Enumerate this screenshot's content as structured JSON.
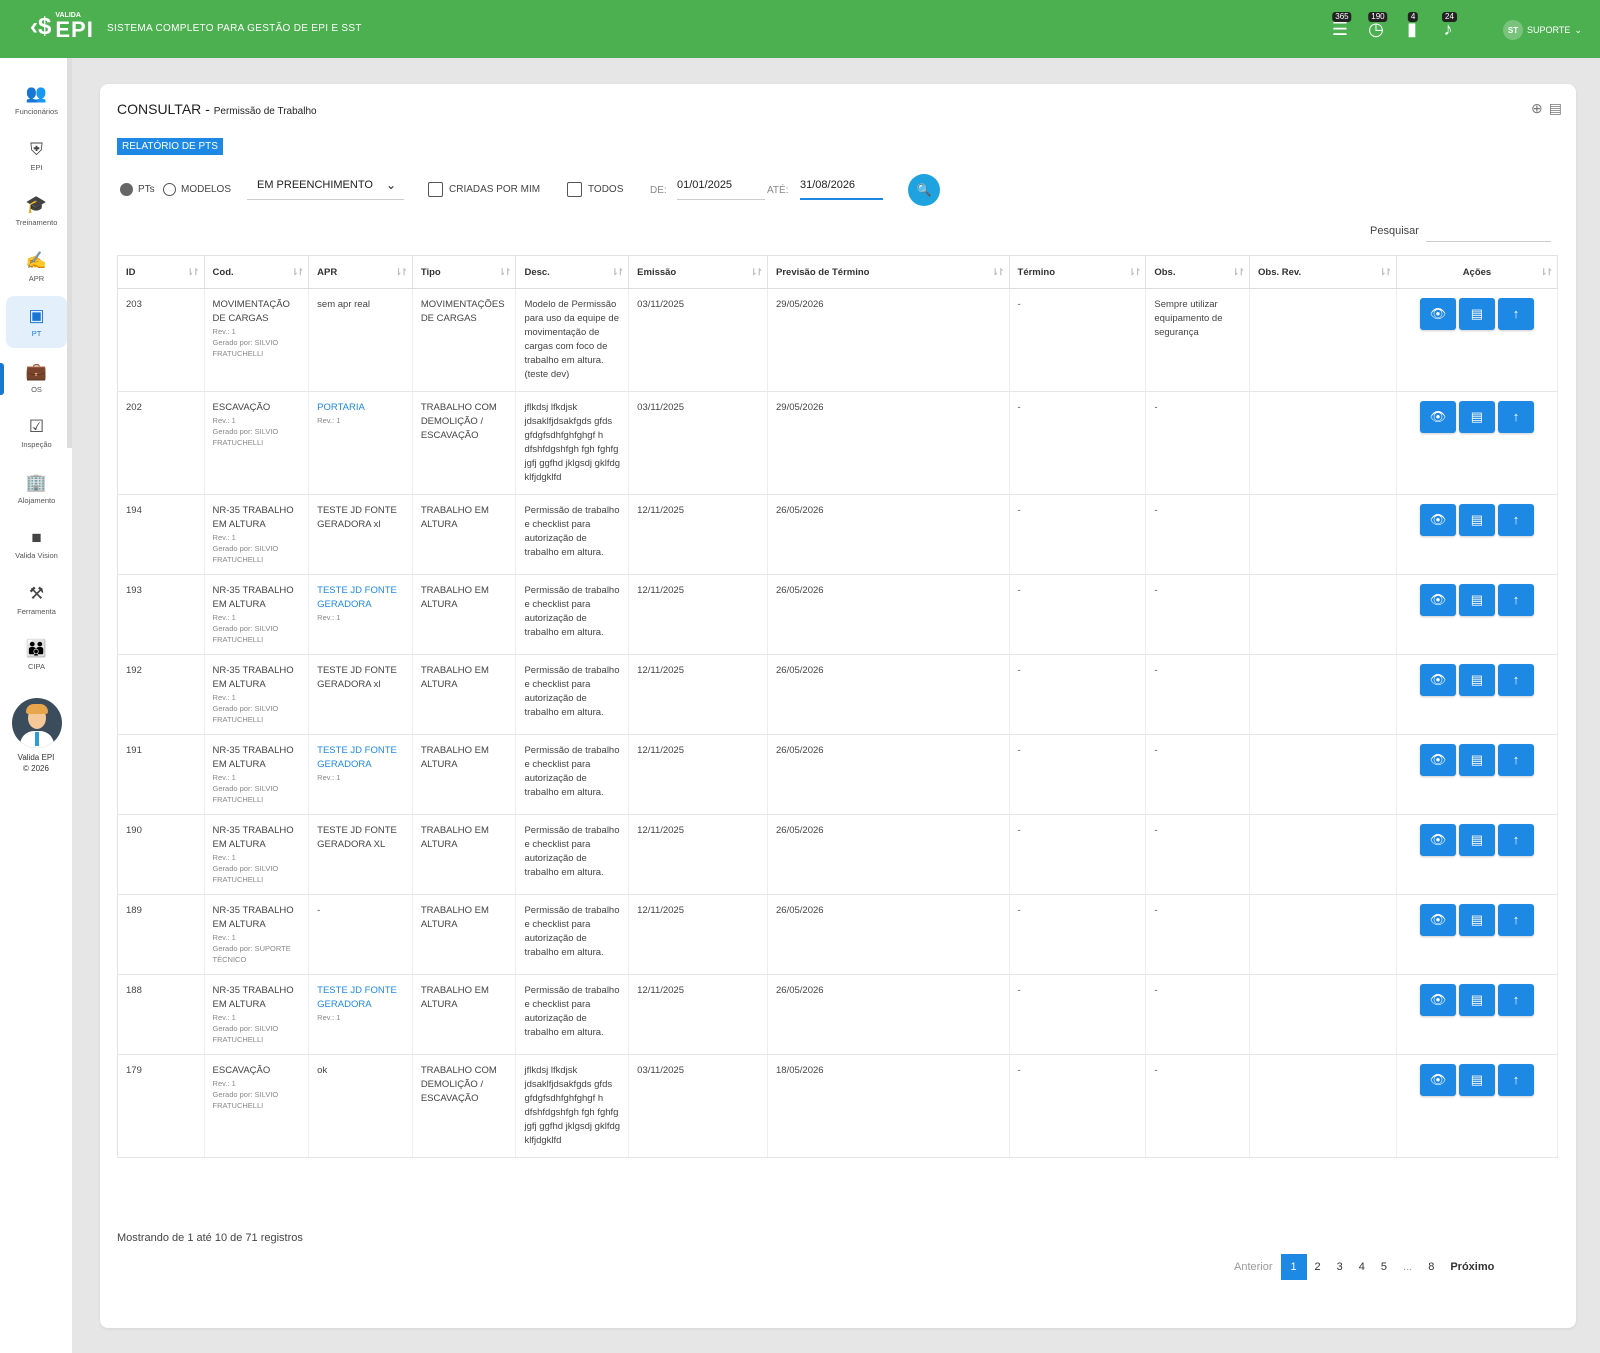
{
  "app": {
    "brand_small": "VALIDA",
    "brand_big": "EPI",
    "system_title": "SISTEMA COMPLETO PARA GESTÃO DE EPI E SST",
    "badges": [
      "365",
      "190",
      "4",
      "24"
    ],
    "user_initials": "ST",
    "user_name": "SUPORTE"
  },
  "sidebar": {
    "items": [
      {
        "label": "Funcionários",
        "icon": "people-icon"
      },
      {
        "label": "EPI",
        "icon": "shield-icon"
      },
      {
        "label": "Treinamento",
        "icon": "graduation-icon"
      },
      {
        "label": "APR",
        "icon": "signature-icon"
      },
      {
        "label": "PT",
        "icon": "folder-user-icon"
      },
      {
        "label": "OS",
        "icon": "briefcase-icon"
      },
      {
        "label": "Inspeção",
        "icon": "checklist-icon"
      },
      {
        "label": "Alojamento",
        "icon": "building-icon"
      },
      {
        "label": "Valida Vision",
        "icon": "video-icon"
      },
      {
        "label": "Ferramenta",
        "icon": "tools-icon"
      },
      {
        "label": "CIPA",
        "icon": "group-icon"
      }
    ],
    "footer_line1": "Valida EPI",
    "footer_line2": "© 2026"
  },
  "page": {
    "title": "CONSULTAR",
    "subtitle": "Permissão de Trabalho",
    "report_button": "RELATÓRIO DE PTS"
  },
  "filters": {
    "radio_pts": "PTs",
    "radio_modelos": "MODELOS",
    "status_select": "EM PREENCHIMENTO",
    "check_criadas": "CRIADAS POR MIM",
    "check_todos": "TODOS",
    "de_label": "DE:",
    "de_value": "01/01/2025",
    "ate_label": "ATÉ:",
    "ate_value": "31/08/2026"
  },
  "search": {
    "label": "Pesquisar",
    "value": ""
  },
  "table": {
    "headers": [
      "ID",
      "Cod.",
      "APR",
      "Tipo",
      "Desc.",
      "Emissão",
      "Previsão de Término",
      "Término",
      "Obs.",
      "Obs. Rev.",
      "Ações"
    ],
    "rows": [
      {
        "id": "203",
        "cod": "MOVIMENTAÇÃO DE CARGAS",
        "rev": "Rev.: 1",
        "gerado": "Gerado por: SILVIO FRATUCHELLI",
        "apr": "sem apr real",
        "apr_link": false,
        "apr_rev": "",
        "tipo": "MOVIMENTAÇÕES DE CARGAS",
        "desc": "Modelo de Permissão para uso da equipe de movimentação de cargas com foco de trabalho em altura. (teste dev)",
        "emissao": "03/11/2025",
        "previsao": "29/05/2026",
        "termino": "-",
        "obs": "Sempre utilizar equipamento de segurança",
        "obsrev": ""
      },
      {
        "id": "202",
        "cod": "ESCAVAÇÃO",
        "rev": "Rev.: 1",
        "gerado": "Gerado por: SILVIO FRATUCHELLI",
        "apr": "PORTARIA",
        "apr_link": true,
        "apr_rev": "Rev.: 1",
        "tipo": "TRABALHO COM DEMOLIÇÃO / ESCAVAÇÃO",
        "desc": "jflkdsj lfkdjsk jdsaklfjdsakfgds gfds gfdgfsdhfghfghgf h dfshfdgshfgh fgh fghfg jgfj ggfhd jklgsdj gklfdg klfjdgklfd",
        "emissao": "03/11/2025",
        "previsao": "29/05/2026",
        "termino": "-",
        "obs": "-",
        "obsrev": ""
      },
      {
        "id": "194",
        "cod": "NR-35 TRABALHO EM ALTURA",
        "rev": "Rev.: 1",
        "gerado": "Gerado por: SILVIO FRATUCHELLI",
        "apr": "TESTE JD FONTE GERADORA xl",
        "apr_link": false,
        "apr_rev": "",
        "tipo": "TRABALHO EM ALTURA",
        "desc": "Permissão de trabalho e checklist para autorização de trabalho em altura.",
        "emissao": "12/11/2025",
        "previsao": "26/05/2026",
        "termino": "-",
        "obs": "-",
        "obsrev": ""
      },
      {
        "id": "193",
        "cod": "NR-35 TRABALHO EM ALTURA",
        "rev": "Rev.: 1",
        "gerado": "Gerado por: SILVIO FRATUCHELLI",
        "apr": "TESTE JD FONTE GERADORA",
        "apr_link": true,
        "apr_rev": "Rev.: 1",
        "tipo": "TRABALHO EM ALTURA",
        "desc": "Permissão de trabalho e checklist para autorização de trabalho em altura.",
        "emissao": "12/11/2025",
        "previsao": "26/05/2026",
        "termino": "-",
        "obs": "-",
        "obsrev": ""
      },
      {
        "id": "192",
        "cod": "NR-35 TRABALHO EM ALTURA",
        "rev": "Rev.: 1",
        "gerado": "Gerado por: SILVIO FRATUCHELLI",
        "apr": "TESTE JD FONTE GERADORA xl",
        "apr_link": false,
        "apr_rev": "",
        "tipo": "TRABALHO EM ALTURA",
        "desc": "Permissão de trabalho e checklist para autorização de trabalho em altura.",
        "emissao": "12/11/2025",
        "previsao": "26/05/2026",
        "termino": "-",
        "obs": "-",
        "obsrev": ""
      },
      {
        "id": "191",
        "cod": "NR-35 TRABALHO EM ALTURA",
        "rev": "Rev.: 1",
        "gerado": "Gerado por: SILVIO FRATUCHELLI",
        "apr": "TESTE JD FONTE GERADORA",
        "apr_link": true,
        "apr_rev": "Rev.: 1",
        "tipo": "TRABALHO EM ALTURA",
        "desc": "Permissão de trabalho e checklist para autorização de trabalho em altura.",
        "emissao": "12/11/2025",
        "previsao": "26/05/2026",
        "termino": "-",
        "obs": "-",
        "obsrev": ""
      },
      {
        "id": "190",
        "cod": "NR-35 TRABALHO EM ALTURA",
        "rev": "Rev.: 1",
        "gerado": "Gerado por: SILVIO FRATUCHELLI",
        "apr": "TESTE JD FONTE GERADORA XL",
        "apr_link": false,
        "apr_rev": "",
        "tipo": "TRABALHO EM ALTURA",
        "desc": "Permissão de trabalho e checklist para autorização de trabalho em altura.",
        "emissao": "12/11/2025",
        "previsao": "26/05/2026",
        "termino": "-",
        "obs": "-",
        "obsrev": ""
      },
      {
        "id": "189",
        "cod": "NR-35 TRABALHO EM ALTURA",
        "rev": "Rev.: 1",
        "gerado": "Gerado por: SUPORTE TÉCNICO",
        "apr": "-",
        "apr_link": false,
        "apr_rev": "",
        "tipo": "TRABALHO EM ALTURA",
        "desc": "Permissão de trabalho e checklist para autorização de trabalho em altura.",
        "emissao": "12/11/2025",
        "previsao": "26/05/2026",
        "termino": "-",
        "obs": "-",
        "obsrev": ""
      },
      {
        "id": "188",
        "cod": "NR-35 TRABALHO EM ALTURA",
        "rev": "Rev.: 1",
        "gerado": "Gerado por: SILVIO FRATUCHELLI",
        "apr": "TESTE JD FONTE GERADORA",
        "apr_link": true,
        "apr_rev": "Rev.: 1",
        "tipo": "TRABALHO EM ALTURA",
        "desc": "Permissão de trabalho e checklist para autorização de trabalho em altura.",
        "emissao": "12/11/2025",
        "previsao": "26/05/2026",
        "termino": "-",
        "obs": "-",
        "obsrev": ""
      },
      {
        "id": "179",
        "cod": "ESCAVAÇÃO",
        "rev": "Rev.: 1",
        "gerado": "Gerado por: SILVIO FRATUCHELLI",
        "apr": "ok",
        "apr_link": false,
        "apr_rev": "",
        "tipo": "TRABALHO COM DEMOLIÇÃO / ESCAVAÇÃO",
        "desc": "jflkdsj lfkdjsk jdsaklfjdsakfgds gfds gfdgfsdhfghfghgf h dfshfdgshfgh fgh fghfg jgfj ggfhd jklgsdj gklfdg klfjdgklfd",
        "emissao": "03/11/2025",
        "previsao": "18/05/2026",
        "termino": "-",
        "obs": "-",
        "obsrev": ""
      }
    ]
  },
  "footer": {
    "showing": "Mostrando de 1 até 10 de 71 registros",
    "prev": "Anterior",
    "pages": [
      "1",
      "2",
      "3",
      "4",
      "5",
      "...",
      "8"
    ],
    "current_page": "1",
    "next": "Próximo"
  },
  "colors": {
    "topbar": "#4caf50",
    "primary": "#1e88e5",
    "search_fab": "#1fa2e0"
  }
}
